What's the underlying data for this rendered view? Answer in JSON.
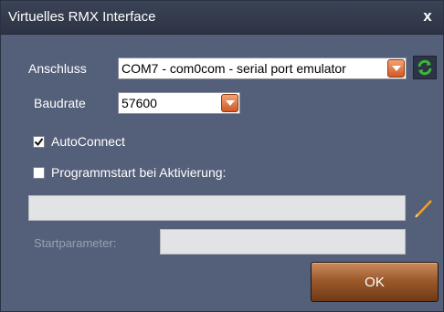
{
  "window": {
    "title": "Virtuelles RMX Interface",
    "close_symbol": "x"
  },
  "connection": {
    "label": "Anschluss",
    "value": "COM7 - com0com - serial port emulator",
    "dropdown_icon": "chevron-down-icon",
    "refresh_icon": "refresh-icon"
  },
  "baudrate": {
    "label": "Baudrate",
    "value": "57600",
    "dropdown_icon": "chevron-down-icon"
  },
  "autoconnect": {
    "label": "AutoConnect",
    "checked": true
  },
  "program_start": {
    "label": "Programmstart bei Aktivierung:",
    "checked": false,
    "path_value": "",
    "edit_icon": "pencil-icon",
    "params_label": "Startparameter:",
    "params_value": ""
  },
  "ok_button": {
    "label": "OK"
  },
  "colors": {
    "window_bg": "#545f79",
    "titlebar_bg": "#2c3344",
    "accent_orange": "#cf5a25",
    "refresh_green": "#3fb43a",
    "ok_button_brown": "#9d5a2c"
  }
}
